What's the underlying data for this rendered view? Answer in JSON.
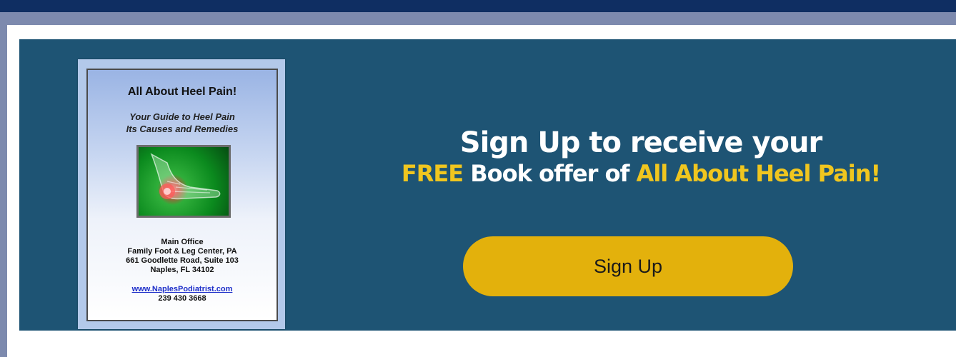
{
  "colors": {
    "top_bar": "#0f2e62",
    "background": "#7d8aae",
    "promo_background": "#1e5474",
    "button": "#e3b10c",
    "highlight": "#f0c61f"
  },
  "book": {
    "title": "All About Heel Pain!",
    "subtitle_lines": [
      "Your Guide to Heel Pain",
      "Its Causes and Remedies"
    ],
    "office_lines": [
      "Main Office",
      "Family Foot & Leg Center, PA",
      "661 Goodlette Road, Suite 103",
      "Naples, FL  34102"
    ],
    "website": "www.NaplesPodiatrist.com",
    "phone": "239 430 3668"
  },
  "headline": {
    "line1": "Sign Up to receive your",
    "free": "FREE",
    "middle": " Book offer of ",
    "book_name": "All About Heel Pain!"
  },
  "cta": {
    "label": "Sign Up"
  }
}
